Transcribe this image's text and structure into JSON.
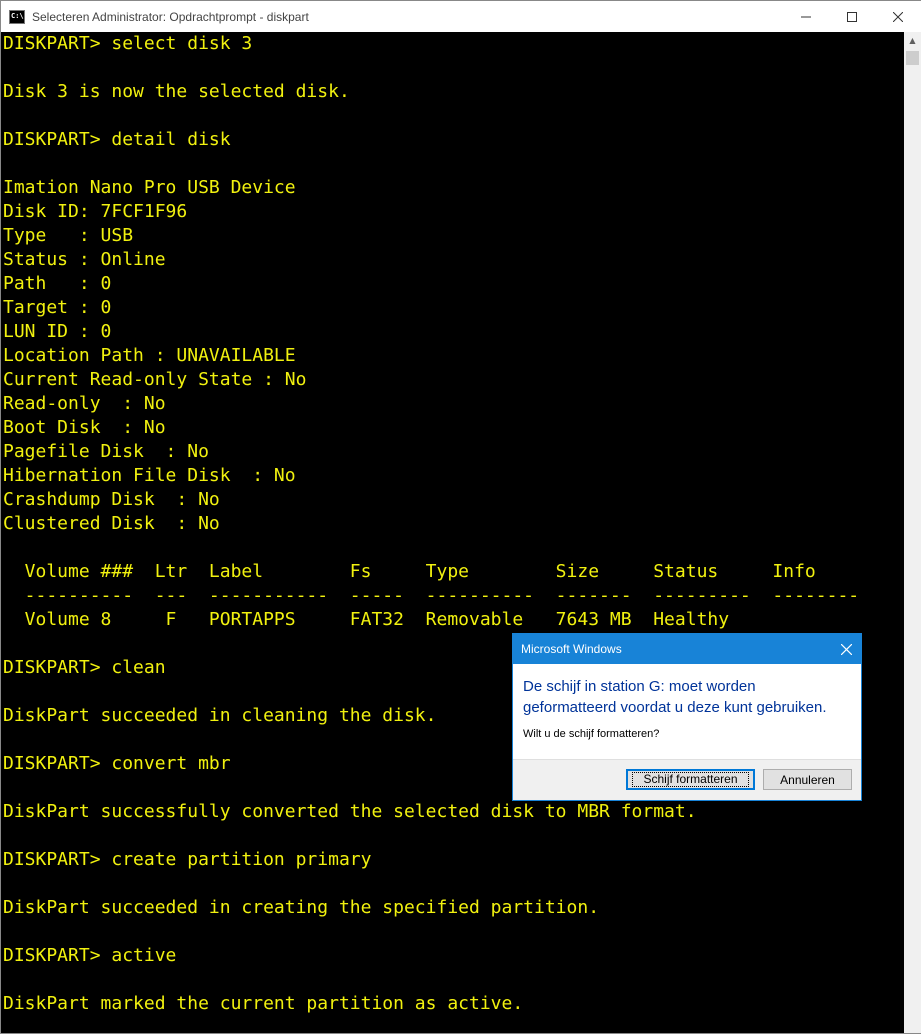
{
  "window": {
    "title": "Selecteren Administrator: Opdrachtprompt - diskpart",
    "icon_text": "C:\\.",
    "controls": [
      "minimize-icon",
      "maximize-icon",
      "close-icon"
    ]
  },
  "terminal": {
    "text_color": "#f1f10f",
    "background": "#000000",
    "lines": [
      "DISKPART> select disk 3",
      "",
      "Disk 3 is now the selected disk.",
      "",
      "DISKPART> detail disk",
      "",
      "Imation Nano Pro USB Device",
      "Disk ID: 7FCF1F96",
      "Type   : USB",
      "Status : Online",
      "Path   : 0",
      "Target : 0",
      "LUN ID : 0",
      "Location Path : UNAVAILABLE",
      "Current Read-only State : No",
      "Read-only  : No",
      "Boot Disk  : No",
      "Pagefile Disk  : No",
      "Hibernation File Disk  : No",
      "Crashdump Disk  : No",
      "Clustered Disk  : No",
      "",
      "  Volume ###  Ltr  Label        Fs     Type        Size     Status     Info",
      "  ----------  ---  -----------  -----  ----------  -------  ---------  --------",
      "  Volume 8     F   PORTAPPS     FAT32  Removable   7643 MB  Healthy",
      "",
      "DISKPART> clean",
      "",
      "DiskPart succeeded in cleaning the disk.",
      "",
      "DISKPART> convert mbr",
      "",
      "DiskPart successfully converted the selected disk to MBR format.",
      "",
      "DISKPART> create partition primary",
      "",
      "DiskPart succeeded in creating the specified partition.",
      "",
      "DISKPART> active",
      "",
      "DiskPart marked the current partition as active."
    ]
  },
  "dialog": {
    "title": "Microsoft Windows",
    "main_instruction": "De schijf in station G: moet worden geformatteerd voordat u deze kunt gebruiken.",
    "content": "Wilt u de schijf formatteren?",
    "primary_button": "Schijf formatteren",
    "cancel_button": "Annuleren",
    "accent_color": "#1883d7"
  }
}
